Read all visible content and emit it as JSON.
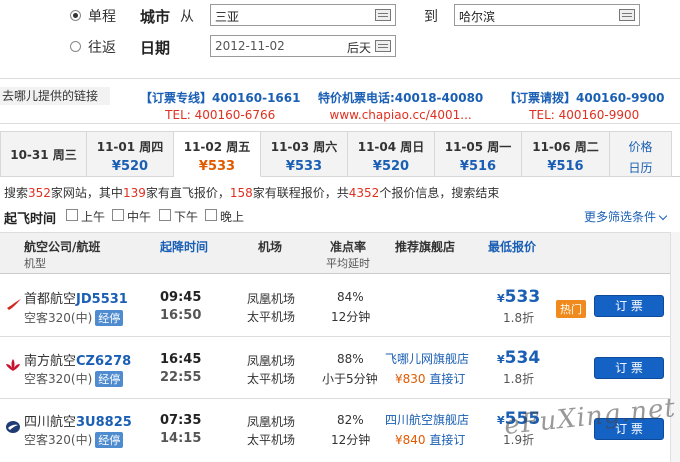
{
  "search": {
    "oneway_label": "单程",
    "roundtrip_label": "往返",
    "city_label": "城市",
    "from_label": "从",
    "from_value": "三亚",
    "to_label": "到",
    "to_value": "哈尔滨",
    "date_label": "日期",
    "date_value": "2012-11-02",
    "date_hint": "后天"
  },
  "ads": {
    "label": "去哪儿提供的链接",
    "items": [
      {
        "title": "【订票专线】400160-1661",
        "sub": "TEL: 400160-6766"
      },
      {
        "title": "特价机票电话:40018-40080",
        "sub": "www.chapiao.cc/4001..."
      },
      {
        "title": "【订票请拨】400160-9900",
        "sub": "TEL: 400160-9900"
      }
    ]
  },
  "date_tabs": [
    {
      "date": "10-31 周三",
      "price": ""
    },
    {
      "date": "11-01 周四",
      "price": "¥520"
    },
    {
      "date": "11-02 周五",
      "price": "¥533"
    },
    {
      "date": "11-03 周六",
      "price": "¥533"
    },
    {
      "date": "11-04 周日",
      "price": "¥520"
    },
    {
      "date": "11-05 周一",
      "price": "¥516"
    },
    {
      "date": "11-06 周二",
      "price": "¥516"
    }
  ],
  "calendar_tab": {
    "line1": "价格",
    "line2": "日历"
  },
  "summary": {
    "p1": "搜索",
    "sites": "352",
    "p2": "家网站，其中",
    "direct": "139",
    "p3": "家有直飞报价，",
    "transfer": "158",
    "p4": "家有联程报价，共",
    "total": "4352",
    "p5": "个报价信息，搜索结束"
  },
  "filter": {
    "label": "起飞时间",
    "options": [
      "上午",
      "中午",
      "下午",
      "晚上"
    ],
    "more": "更多筛选条件"
  },
  "table_header": {
    "airline": "航空公司/航班",
    "model": "机型",
    "time": "起降时间",
    "airport": "机场",
    "ontime": "准点率",
    "delay": "平均延时",
    "shop": "推荐旗舰店",
    "price": "最低报价"
  },
  "flights": [
    {
      "airline": "首都航空",
      "flight": "JD5531",
      "model": "空客320(中)",
      "stop": "经停",
      "dep": "09:45",
      "arr": "16:50",
      "dep_airport": "凤凰机场",
      "arr_airport": "太平机场",
      "ontime": "84%",
      "delay": "12分钟",
      "shop": "",
      "shop_price": "",
      "shop_buy": "",
      "price": "533",
      "discount": "1.8折",
      "hot": "热门",
      "book": "订 票"
    },
    {
      "airline": "南方航空",
      "flight": "CZ6278",
      "model": "空客320(中)",
      "stop": "经停",
      "dep": "16:45",
      "arr": "22:55",
      "dep_airport": "凤凰机场",
      "arr_airport": "太平机场",
      "ontime": "88%",
      "delay": "小于5分钟",
      "shop": "飞哪儿网旗舰店",
      "shop_price": "¥830",
      "shop_buy": "直接订",
      "price": "534",
      "discount": "1.8折",
      "hot": "",
      "book": "订 票"
    },
    {
      "airline": "四川航空",
      "flight": "3U8825",
      "model": "空客320(中)",
      "stop": "经停",
      "dep": "07:35",
      "arr": "14:15",
      "dep_airport": "凤凰机场",
      "arr_airport": "太平机场",
      "ontime": "82%",
      "delay": "12分钟",
      "shop": "四川航空旗舰店",
      "shop_price": "¥840",
      "shop_buy": "直接订",
      "price": "555",
      "discount": "1.9折",
      "hot": "",
      "book": "订 票"
    }
  ],
  "currency": "¥",
  "watermark": "eFuXing.net",
  "colors": {
    "link_blue": "#1a5fb4",
    "highlight_red": "#e03020",
    "orange": "#e05a00",
    "button_blue": "#1462c4"
  }
}
